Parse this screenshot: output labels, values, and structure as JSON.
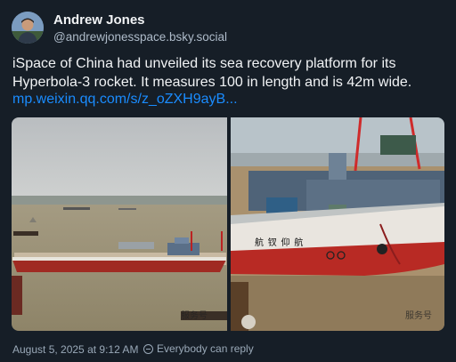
{
  "author": {
    "display_name": "Andrew Jones",
    "handle": "@andrewjonesspace.bsky.social"
  },
  "post": {
    "text": "iSpace of China had unveiled its sea recovery platform for its Hyperbola-3 rocket. It measures 100 in length and is 42m wide.",
    "link": "mp.weixin.qq.com/s/z_oZXH9ayB...",
    "timestamp": "August 5, 2025 at 9:12 AM",
    "reply_setting": "Everybody can reply"
  },
  "images": {
    "left_watermark": "服务号",
    "right_watermark": "服务号",
    "ship_name": "航 钗 仰 航"
  },
  "colors": {
    "background": "#161e27",
    "link": "#1a8cff",
    "secondary_text": "#9aa9b8"
  }
}
